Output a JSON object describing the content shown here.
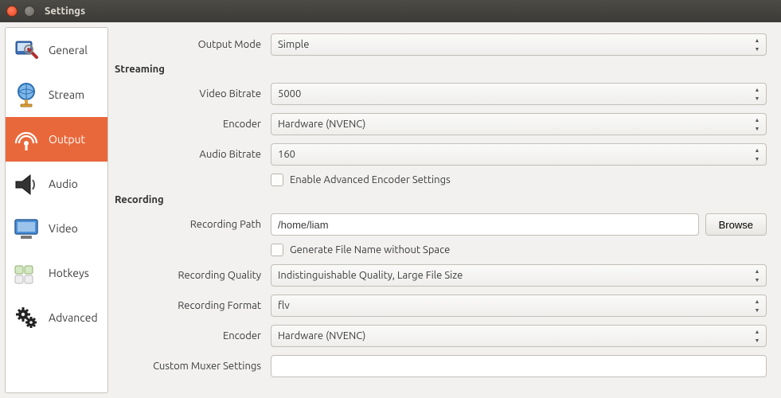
{
  "window": {
    "title": "Settings"
  },
  "sidebar": {
    "items": [
      {
        "label": "General"
      },
      {
        "label": "Stream"
      },
      {
        "label": "Output"
      },
      {
        "label": "Audio"
      },
      {
        "label": "Video"
      },
      {
        "label": "Hotkeys"
      },
      {
        "label": "Advanced"
      }
    ],
    "active": "Output"
  },
  "output": {
    "mode_label": "Output Mode",
    "mode_value": "Simple",
    "streaming": {
      "section": "Streaming",
      "video_bitrate_label": "Video Bitrate",
      "video_bitrate_value": "5000",
      "encoder_label": "Encoder",
      "encoder_value": "Hardware (NVENC)",
      "audio_bitrate_label": "Audio Bitrate",
      "audio_bitrate_value": "160",
      "advanced_checkbox_label": "Enable Advanced Encoder Settings"
    },
    "recording": {
      "section": "Recording",
      "path_label": "Recording Path",
      "path_value": "/home/liam",
      "browse": "Browse",
      "no_space_checkbox_label": "Generate File Name without Space",
      "quality_label": "Recording Quality",
      "quality_value": "Indistinguishable Quality, Large File Size",
      "format_label": "Recording Format",
      "format_value": "flv",
      "encoder_label": "Encoder",
      "encoder_value": "Hardware (NVENC)",
      "muxer_label": "Custom Muxer Settings",
      "muxer_value": ""
    }
  }
}
